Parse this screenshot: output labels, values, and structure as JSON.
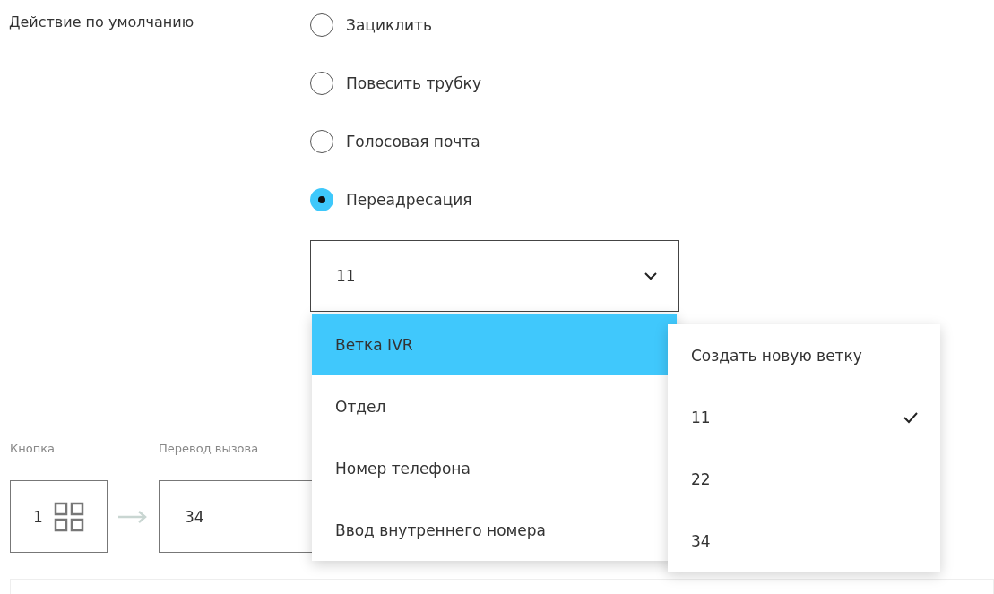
{
  "default_action": {
    "label": "Действие по умолчанию",
    "options": [
      {
        "label": "Зациклить",
        "selected": false
      },
      {
        "label": "Повесить трубку",
        "selected": false
      },
      {
        "label": "Голосовая почта",
        "selected": false
      },
      {
        "label": "Переадресация",
        "selected": true
      }
    ],
    "select": {
      "value": "11"
    }
  },
  "dropdown": {
    "items": [
      {
        "label": "Ветка IVR",
        "selected": true
      },
      {
        "label": "Отдел",
        "selected": false
      },
      {
        "label": "Номер телефона",
        "selected": false
      },
      {
        "label": "Ввод внутреннего номера",
        "selected": false
      }
    ]
  },
  "submenu": {
    "items": [
      {
        "label": "Создать новую ветку",
        "selected": false
      },
      {
        "label": "11",
        "selected": true
      },
      {
        "label": "22",
        "selected": false
      },
      {
        "label": "34",
        "selected": false
      }
    ]
  },
  "mapping": {
    "button_label": "Кнопка",
    "transfer_label": "Перевод вызова",
    "button_value": "1",
    "transfer_value": "34"
  }
}
